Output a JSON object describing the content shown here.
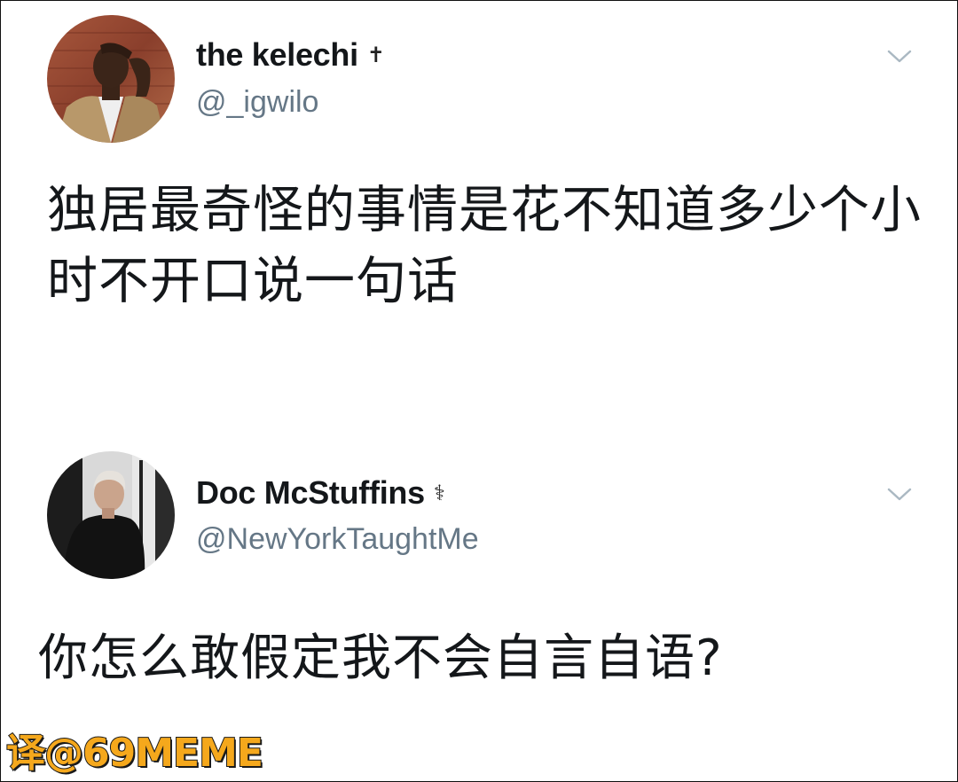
{
  "tweets": [
    {
      "display_name": "the kelechi",
      "badge": "✝",
      "handle": "@_igwilo",
      "avatar": "avatar-man-icon",
      "menu_icon": "chevron-down-icon",
      "text": "独居最奇怪的事情是花不知道多少个小时不开口说一句话"
    },
    {
      "display_name": "Doc McStuffins",
      "badge": "⚕",
      "handle": "@NewYorkTaughtMe",
      "avatar": "avatar-woman-icon",
      "menu_icon": "chevron-down-icon",
      "text": "你怎么敢假定我不会自言自语?"
    }
  ],
  "watermark": "译@69MEME",
  "colors": {
    "name": "#14171a",
    "handle": "#657786",
    "chevron": "#aab8c2",
    "watermark_fill": "#f5a81c",
    "watermark_stroke": "#1a1a1a"
  }
}
